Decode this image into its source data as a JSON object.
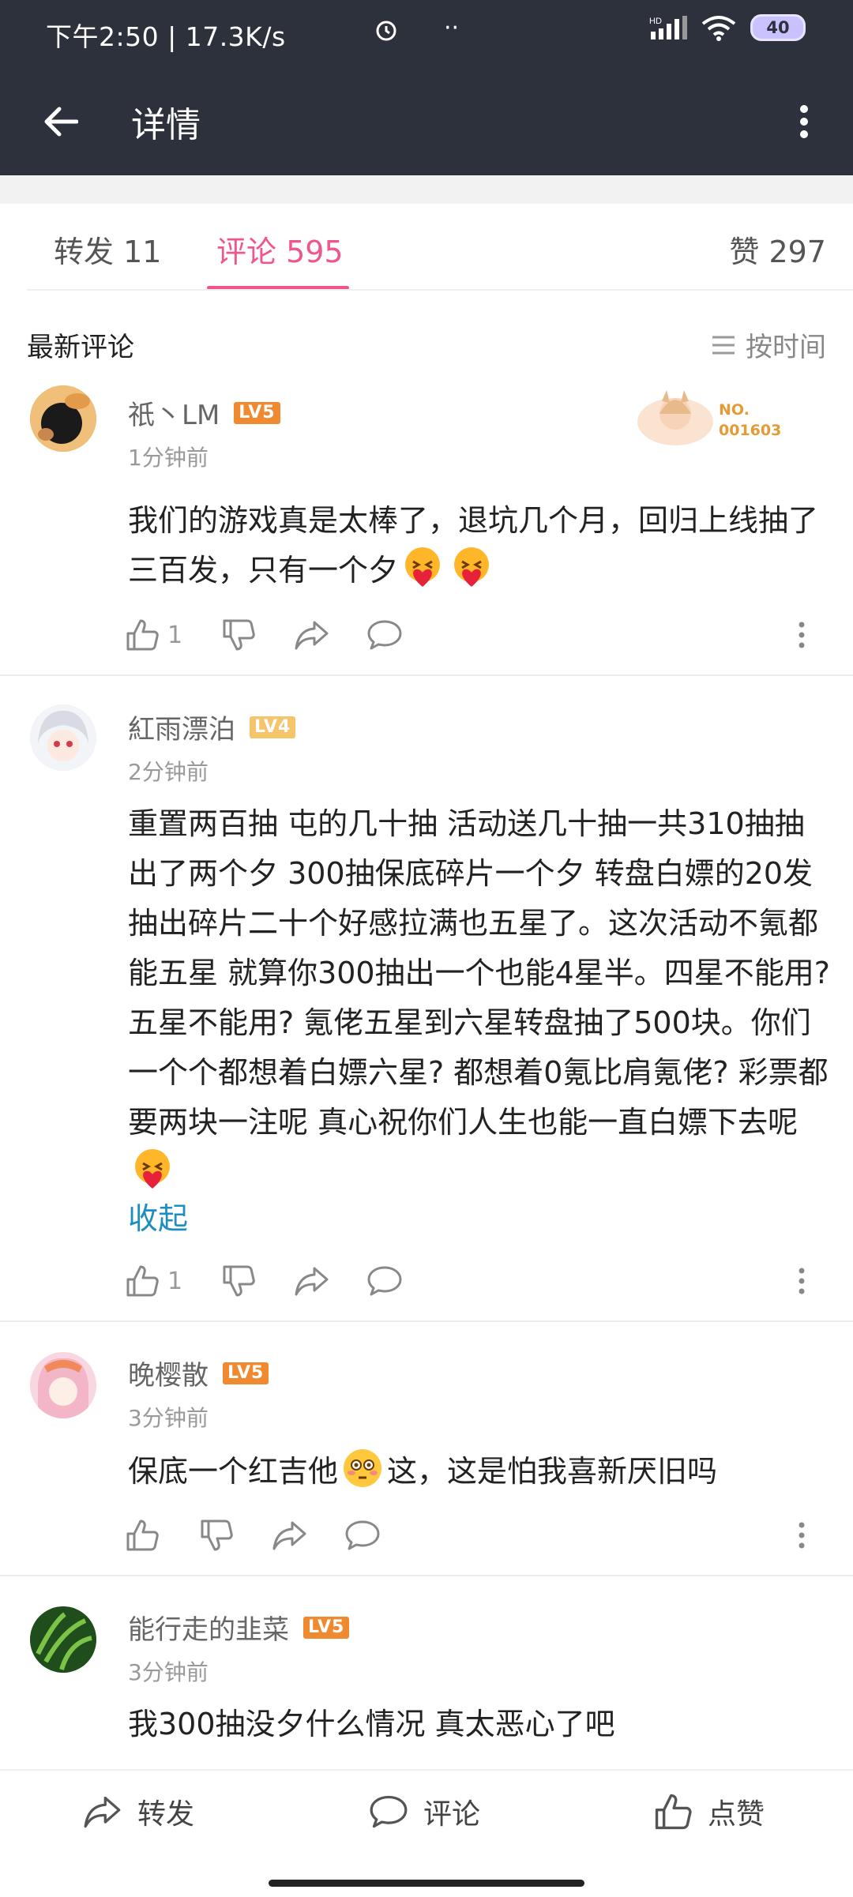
{
  "status": {
    "time": "下午2:50 | 17.3K/s",
    "battery": "40",
    "network": "HD"
  },
  "header": {
    "title": "详情"
  },
  "tabs": [
    {
      "label": "转发 11"
    },
    {
      "label": "评论 595"
    },
    {
      "label": "赞 297"
    }
  ],
  "section": {
    "title": "最新评论",
    "sort_label": "按时间"
  },
  "badge": {
    "line1": "NO.",
    "line2": "001603"
  },
  "comments": [
    {
      "user": "祇丶LM",
      "level": "LV5",
      "time": "1分钟前",
      "text_a": "我们的游戏真是太棒了，退坑几个月，回归上线抽了三百发，只有一个夕",
      "likes": "1"
    },
    {
      "user": "紅雨漂泊",
      "level": "LV4",
      "time": "2分钟前",
      "text_a": "重置两百抽 屯的几十抽 活动送几十抽一共310抽抽出了两个夕 300抽保底碎片一个夕 转盘白嫖的20发抽出碎片二十个好感拉满也五星了。这次活动不氪都能五星 就算你300抽出一个也能4星半。四星不能用? 五星不能用? 氪佬五星到六星转盘抽了500块。你们一个个都想着白嫖六星? 都想着0氪比肩氪佬? 彩票都要两块一注呢 真心祝你们人生也能一直白嫖下去呢",
      "collapse": "收起",
      "likes": "1"
    },
    {
      "user": "晚樱散",
      "level": "LV5",
      "time": "3分钟前",
      "text_a": "保底一个红吉他",
      "text_b": "这，这是怕我喜新厌旧吗",
      "likes": ""
    },
    {
      "user": "能行走的韭菜",
      "level": "LV5",
      "time": "3分钟前",
      "text_a": "我300抽没夕什么情况 真太恶心了吧"
    }
  ],
  "bottom_bar": {
    "forward": "转发",
    "comment": "评论",
    "like": "点赞"
  },
  "colors": {
    "accent": "#f0568d",
    "topbar": "#2c313b",
    "link": "#1e8dc1",
    "lv5": "#f08a30",
    "lv4": "#f6c46a"
  }
}
